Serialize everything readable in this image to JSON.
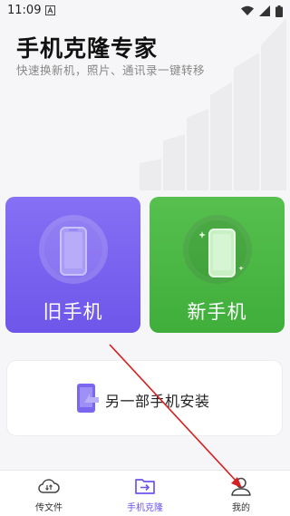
{
  "status_bar": {
    "time": "11:09",
    "notification_icon": "a-box-icon",
    "icons": [
      "wifi-icon",
      "signal-icon",
      "battery-icon"
    ]
  },
  "header": {
    "title": "手机克隆专家",
    "subtitle": "快速换新机，照片、通讯录一键转移"
  },
  "cards": {
    "old_phone": {
      "label": "旧手机",
      "color": "#7460f0"
    },
    "new_phone": {
      "label": "新手机",
      "color": "#4cb845"
    }
  },
  "install": {
    "label": "另一部手机安装"
  },
  "bottom_nav": {
    "items": [
      {
        "label": "传文件",
        "icon": "cloud-transfer-icon",
        "active": false
      },
      {
        "label": "手机克隆",
        "icon": "folder-transfer-icon",
        "active": true
      },
      {
        "label": "我的",
        "icon": "person-icon",
        "active": false
      }
    ]
  },
  "colors": {
    "accent": "#6b55ee",
    "arrow": "#d42020"
  }
}
